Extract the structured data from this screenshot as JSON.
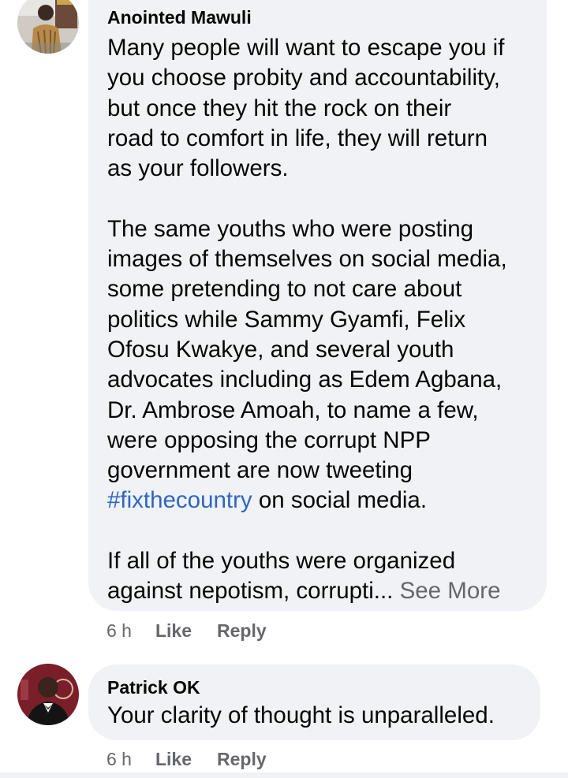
{
  "comments": [
    {
      "author": "Anointed Mawuli",
      "lines": [
        "Many people will want to escape you if",
        "you choose probity and accountability,",
        "but once they hit the rock on their",
        "road to comfort in life, they will return",
        "as your followers.",
        "",
        "The same youths who were posting",
        "images of themselves on social media,",
        "some pretending to not care about",
        "politics while Sammy Gyamfi, Felix",
        "Ofosu Kwakye, and several youth",
        "advocates including as Edem Agbana,",
        "Dr. Ambrose Amoah, to name a few,",
        "were opposing the corrupt NPP",
        "government are now tweeting",
        "",
        "",
        "If all of the youths were organized",
        "against nepotism, corrupti..."
      ],
      "hashtag": "#fixthecountry",
      "hashtag_suffix": " on social media.",
      "see_more": "See More",
      "time": "6 h",
      "like": "Like",
      "reply": "Reply"
    },
    {
      "author": "Patrick OK",
      "lines": [
        "Your clarity of thought is unparalleled."
      ],
      "time": "6 h",
      "like": "Like",
      "reply": "Reply"
    }
  ],
  "colors": {
    "bubble": "#f0f2f5",
    "hashtag": "#2d66c4",
    "secondary_text": "#65676b"
  }
}
